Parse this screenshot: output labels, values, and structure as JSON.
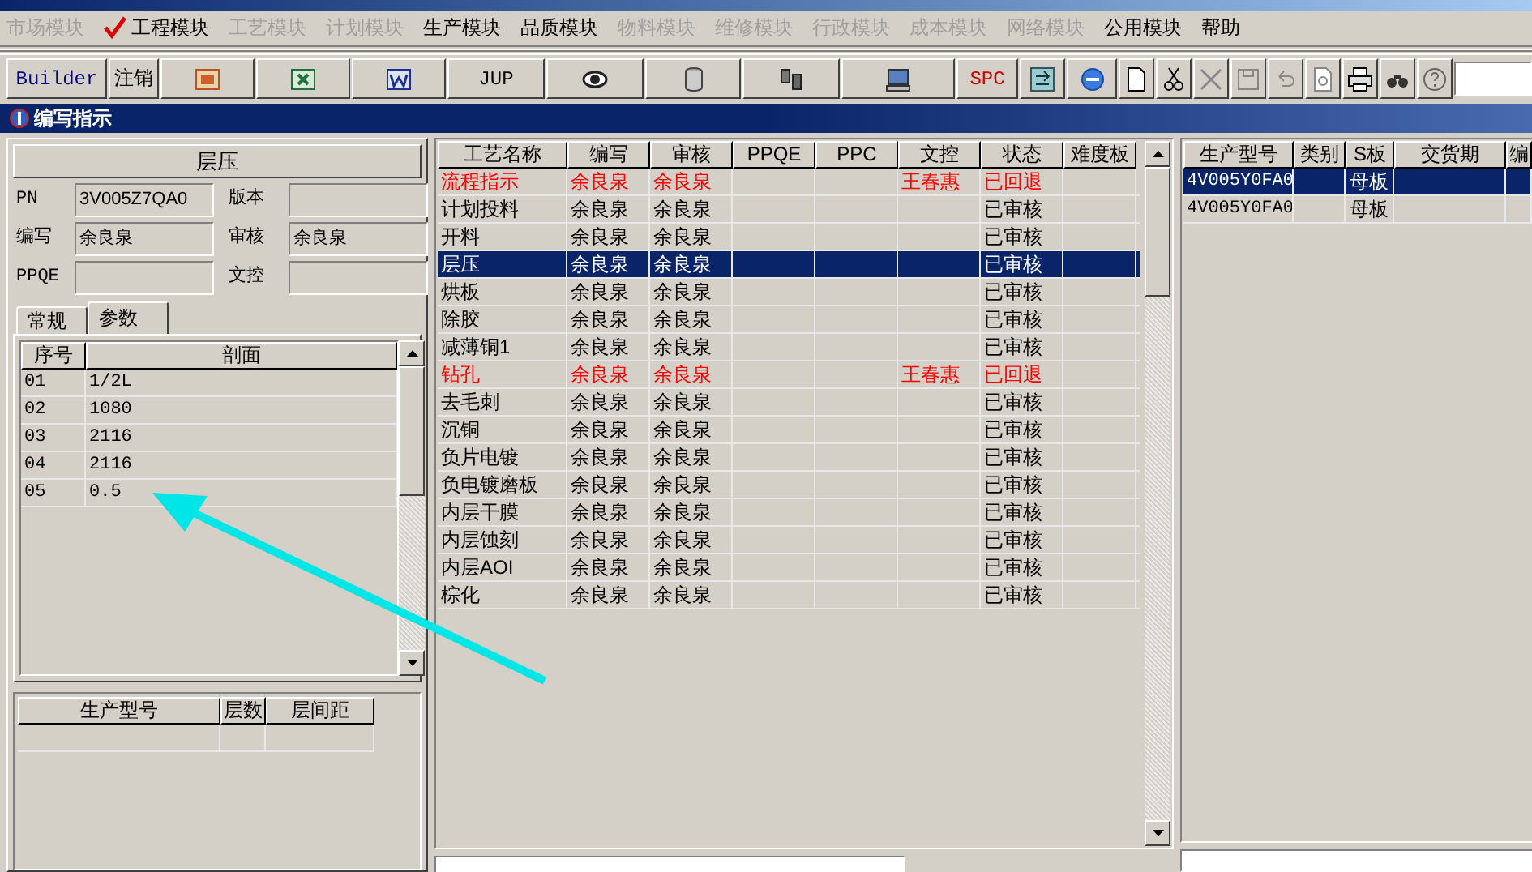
{
  "menu": [
    {
      "label": "市场模块",
      "enabled": false,
      "selected": false
    },
    {
      "label": "工程模块",
      "enabled": true,
      "selected": true
    },
    {
      "label": "工艺模块",
      "enabled": false,
      "selected": false
    },
    {
      "label": "计划模块",
      "enabled": false,
      "selected": false
    },
    {
      "label": "生产模块",
      "enabled": true,
      "selected": false
    },
    {
      "label": "品质模块",
      "enabled": true,
      "selected": false
    },
    {
      "label": "物料模块",
      "enabled": false,
      "selected": false
    },
    {
      "label": "维修模块",
      "enabled": false,
      "selected": false
    },
    {
      "label": "行政模块",
      "enabled": false,
      "selected": false
    },
    {
      "label": "成本模块",
      "enabled": false,
      "selected": false
    },
    {
      "label": "网络模块",
      "enabled": false,
      "selected": false
    },
    {
      "label": "公用模块",
      "enabled": true,
      "selected": false
    },
    {
      "label": "帮助",
      "enabled": true,
      "selected": false
    }
  ],
  "toolbar": [
    {
      "kind": "text",
      "label": "Builder"
    },
    {
      "kind": "text",
      "label": "注销"
    },
    {
      "kind": "icon"
    },
    {
      "kind": "icon"
    },
    {
      "kind": "icon"
    },
    {
      "kind": "text",
      "label": "JUP"
    },
    {
      "kind": "icon"
    },
    {
      "kind": "icon"
    },
    {
      "kind": "icon"
    },
    {
      "kind": "icon"
    },
    {
      "kind": "text",
      "label": "SPC"
    },
    {
      "kind": "icon"
    },
    {
      "kind": "icon"
    },
    {
      "kind": "icon"
    },
    {
      "kind": "icon"
    },
    {
      "kind": "icon"
    },
    {
      "kind": "icon"
    },
    {
      "kind": "icon"
    },
    {
      "kind": "icon"
    },
    {
      "kind": "icon"
    },
    {
      "kind": "icon"
    },
    {
      "kind": "icon"
    }
  ],
  "window": {
    "title": "编写指示"
  },
  "process": {
    "title": "层压",
    "fields": [
      {
        "label": "PN",
        "value": "3V005Z7QA0"
      },
      {
        "label": "版本"
      },
      {
        "label": "编写",
        "value": "余良泉"
      },
      {
        "label": "审核",
        "value": "余良泉"
      },
      {
        "label": "PPQE"
      },
      {
        "label": "文控"
      }
    ],
    "tabs": [
      {
        "label": "常规",
        "selected": false
      },
      {
        "label": "参数",
        "selected": true
      }
    ],
    "params": {
      "columns": [
        "序号",
        "剖面"
      ],
      "rows": [
        [
          "01",
          "1/2L"
        ],
        [
          "02",
          "1080"
        ],
        [
          "03",
          "2116"
        ],
        [
          "04",
          "2116"
        ],
        [
          "05",
          "0.5"
        ]
      ]
    },
    "layers": {
      "columns": [
        "生产型号",
        "层数",
        "层间距"
      ]
    }
  },
  "steps": {
    "columns": [
      "工艺名称",
      "编写",
      "审核",
      "PPQE",
      "PPC",
      "文控",
      "状态",
      "难度板"
    ],
    "rows": [
      {
        "cells": [
          "流程指示",
          "余良泉",
          "余良泉",
          "",
          "",
          "王春惠",
          "已回退",
          ""
        ],
        "returned": true,
        "selected": false
      },
      {
        "cells": [
          "计划投料",
          "余良泉",
          "余良泉",
          "",
          "",
          "",
          "已审核",
          ""
        ],
        "returned": false,
        "selected": false
      },
      {
        "cells": [
          "开料",
          "余良泉",
          "余良泉",
          "",
          "",
          "",
          "已审核",
          ""
        ],
        "returned": false,
        "selected": false
      },
      {
        "cells": [
          "层压",
          "余良泉",
          "余良泉",
          "",
          "",
          "",
          "已审核",
          ""
        ],
        "returned": false,
        "selected": true
      },
      {
        "cells": [
          "烘板",
          "余良泉",
          "余良泉",
          "",
          "",
          "",
          "已审核",
          ""
        ],
        "returned": false,
        "selected": false
      },
      {
        "cells": [
          "除胶",
          "余良泉",
          "余良泉",
          "",
          "",
          "",
          "已审核",
          ""
        ],
        "returned": false,
        "selected": false
      },
      {
        "cells": [
          "减薄铜1",
          "余良泉",
          "余良泉",
          "",
          "",
          "",
          "已审核",
          ""
        ],
        "returned": false,
        "selected": false
      },
      {
        "cells": [
          "钻孔",
          "余良泉",
          "余良泉",
          "",
          "",
          "王春惠",
          "已回退",
          ""
        ],
        "returned": true,
        "selected": false
      },
      {
        "cells": [
          "去毛刺",
          "余良泉",
          "余良泉",
          "",
          "",
          "",
          "已审核",
          ""
        ],
        "returned": false,
        "selected": false
      },
      {
        "cells": [
          "沉铜",
          "余良泉",
          "余良泉",
          "",
          "",
          "",
          "已审核",
          ""
        ],
        "returned": false,
        "selected": false
      },
      {
        "cells": [
          "负片电镀",
          "余良泉",
          "余良泉",
          "",
          "",
          "",
          "已审核",
          ""
        ],
        "returned": false,
        "selected": false
      },
      {
        "cells": [
          "负电镀磨板",
          "余良泉",
          "余良泉",
          "",
          "",
          "",
          "已审核",
          ""
        ],
        "returned": false,
        "selected": false
      },
      {
        "cells": [
          "内层干膜",
          "余良泉",
          "余良泉",
          "",
          "",
          "",
          "已审核",
          ""
        ],
        "returned": false,
        "selected": false
      },
      {
        "cells": [
          "内层蚀刻",
          "余良泉",
          "余良泉",
          "",
          "",
          "",
          "已审核",
          ""
        ],
        "returned": false,
        "selected": false
      },
      {
        "cells": [
          "内层AOI",
          "余良泉",
          "余良泉",
          "",
          "",
          "",
          "已审核",
          ""
        ],
        "returned": false,
        "selected": false
      },
      {
        "cells": [
          "棕化",
          "余良泉",
          "余良泉",
          "",
          "",
          "",
          "已审核",
          ""
        ],
        "returned": false,
        "selected": false
      }
    ]
  },
  "models": {
    "columns": [
      "生产型号",
      "类别",
      "S板",
      "交货期",
      "编"
    ],
    "rows": [
      {
        "cells": [
          "4V005Y0FA0",
          "",
          "母板",
          "",
          ""
        ],
        "selected": true
      },
      {
        "cells": [
          "4V005Y0FA0",
          "",
          "母板",
          "",
          ""
        ],
        "selected": false
      }
    ]
  }
}
